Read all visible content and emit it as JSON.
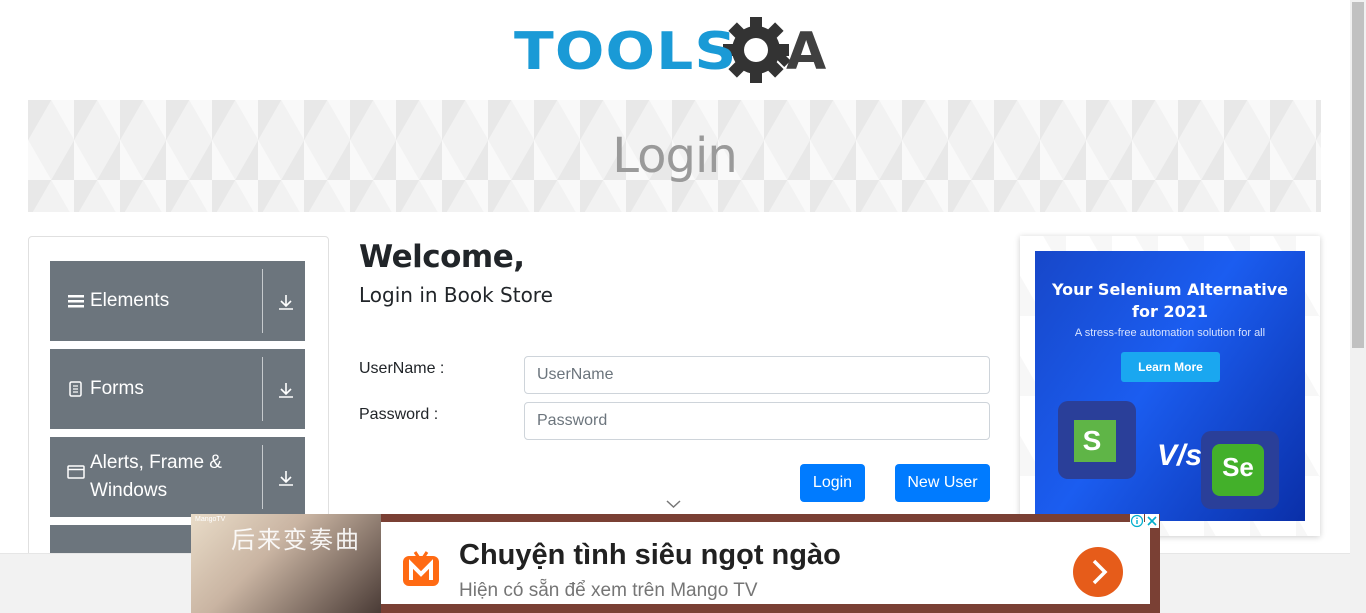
{
  "header": {
    "logo_text": "TOOLS",
    "logo_q": "Q",
    "logo_a": "A"
  },
  "banner": {
    "title": "Login"
  },
  "sidebar": {
    "groups": [
      {
        "label": "Elements",
        "icon": "hamburger-icon"
      },
      {
        "label": "Forms",
        "icon": "document-icon"
      },
      {
        "label": "Alerts, Frame & Windows",
        "icon": "window-icon"
      }
    ]
  },
  "main": {
    "welcome": "Welcome,",
    "subtitle": "Login in Book Store",
    "username_label": "UserName :",
    "username_placeholder": "UserName",
    "password_label": "Password :",
    "password_placeholder": "Password",
    "login_button": "Login",
    "new_user_button": "New User"
  },
  "side_ad": {
    "title_line1": "Your Selenium Alternative",
    "title_line2": "for 2021",
    "subtitle": "A stress-free automation solution for all",
    "cta": "Learn More",
    "left_letter": "S",
    "vs": "V/s",
    "right_letter": "Se"
  },
  "bottom_ad": {
    "brand": "MangoTV",
    "image_title": "后来变奏曲",
    "headline": "Chuyện tình siêu ngọt ngào",
    "subline": "Hiện có sẵn để xem trên Mango TV"
  },
  "colors": {
    "brand_blue": "#1a9ad6",
    "sidebar_gray": "#6c757d",
    "primary_button": "#007bff",
    "ad_orange": "#e65c1a"
  }
}
